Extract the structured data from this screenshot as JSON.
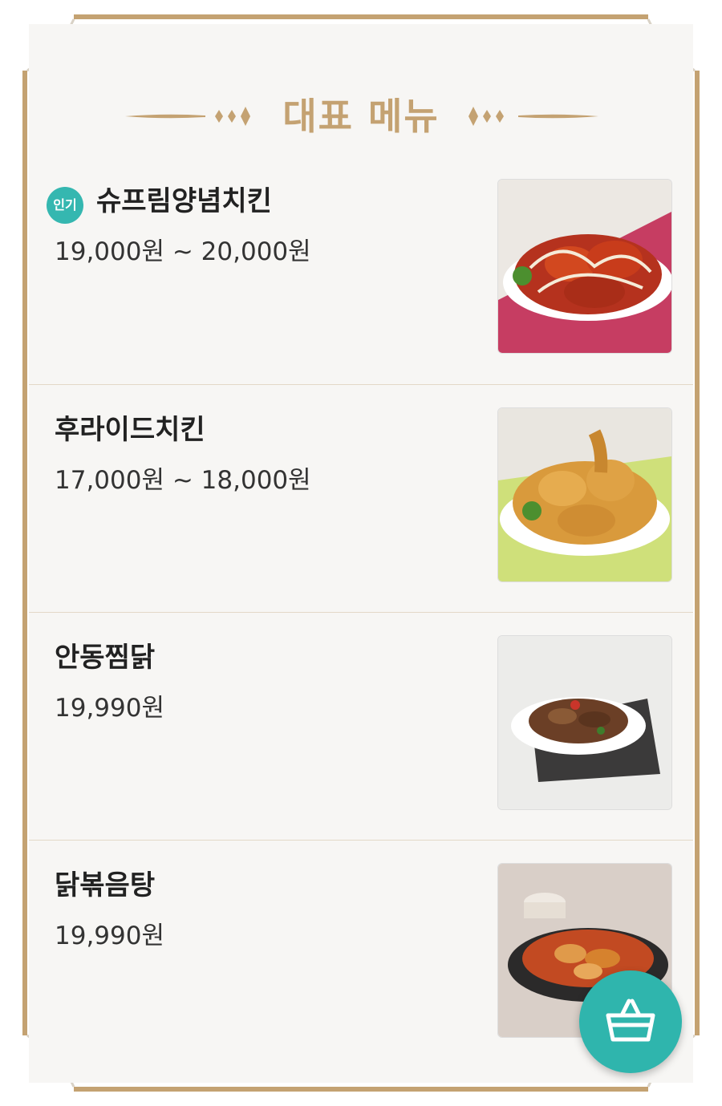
{
  "section": {
    "title": "대표 메뉴"
  },
  "colors": {
    "accent_gold": "#c4a272",
    "badge_teal": "#35b7b0",
    "fab_teal": "#2fb5ad"
  },
  "menu": {
    "items": [
      {
        "badge": "인기",
        "name": "슈프림양념치킨",
        "price": "19,000원 ~ 20,000원",
        "photo_icon": "seasoned-chicken-photo"
      },
      {
        "name": "후라이드치킨",
        "price": "17,000원 ~ 18,000원",
        "photo_icon": "fried-chicken-photo"
      },
      {
        "name": "안동찜닭",
        "price": "19,990원",
        "photo_icon": "braised-chicken-photo"
      },
      {
        "name": "닭볶음탕",
        "price": "19,990원",
        "photo_icon": "spicy-chicken-stew-photo"
      }
    ]
  },
  "fab": {
    "icon": "shopping-basket-icon"
  }
}
